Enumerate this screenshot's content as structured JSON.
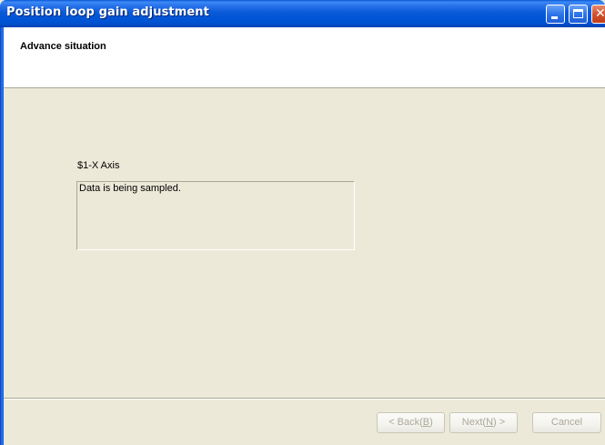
{
  "window": {
    "title": "Position loop gain adjustment",
    "controls": {
      "minimize_icon": "minimize-icon",
      "maximize_icon": "maximize-icon",
      "close_icon": "close-icon"
    }
  },
  "header": {
    "title": "Advance situation"
  },
  "main": {
    "axis_label": "$1-X Axis",
    "status_message": "Data is being sampled."
  },
  "footer": {
    "back_label": "< Back(B)",
    "next_label": "Next(N) >",
    "cancel_label": "Cancel",
    "buttons_enabled": false
  },
  "colors": {
    "titlebar": "#0055d6",
    "dialog_bg": "#ece9d8",
    "disabled_text": "#aca899"
  }
}
